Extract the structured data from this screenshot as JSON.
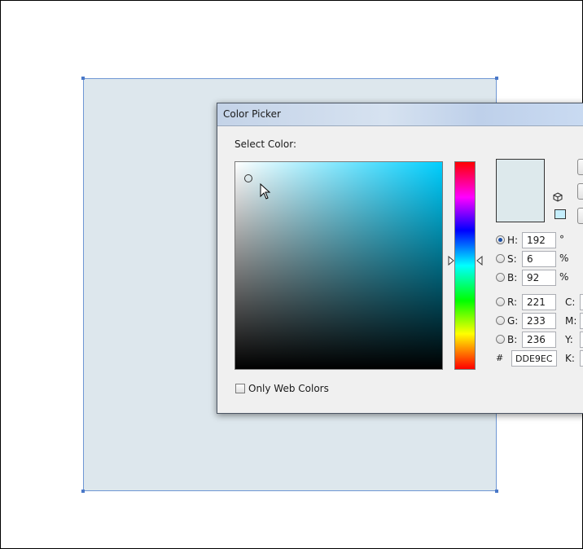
{
  "dialog": {
    "title": "Color Picker",
    "select_color_label": "Select Color:",
    "only_web_colors_label": "Only Web Colors",
    "new_color": "#dde9ec",
    "hsb": [
      {
        "label": "H:",
        "value": "192",
        "unit": "°",
        "selected": true
      },
      {
        "label": "S:",
        "value": "6",
        "unit": "%",
        "selected": false
      },
      {
        "label": "B:",
        "value": "92",
        "unit": "%",
        "selected": false
      }
    ],
    "rgb": [
      {
        "label": "R:",
        "value": "221",
        "cmyk_label": "C:"
      },
      {
        "label": "G:",
        "value": "233",
        "cmyk_label": "M:"
      },
      {
        "label": "B:",
        "value": "236",
        "cmyk_label": "Y:"
      }
    ],
    "hex": {
      "label": "#",
      "value": "DDE9EC",
      "cmyk_label": "K:"
    },
    "icons": [
      "cube-icon",
      "websafe-swatch-icon",
      "mouse-cursor-icon"
    ]
  },
  "artboard": {
    "fill": "#dde7ed",
    "stroke": "#6f97d4"
  }
}
